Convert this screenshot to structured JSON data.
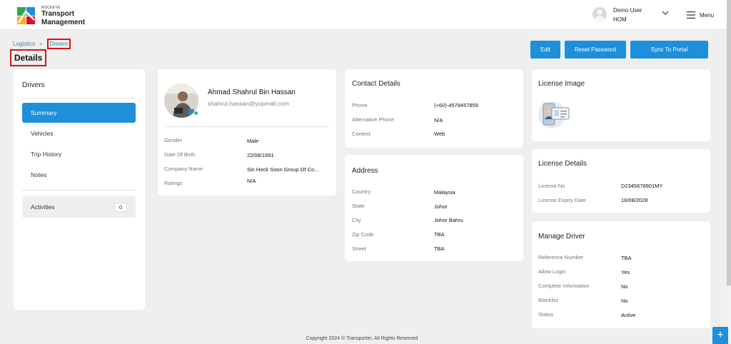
{
  "brand": {
    "tagline": "ROCKEYE",
    "line1": "Transport",
    "line2": "Management"
  },
  "user": {
    "name": "Demo User",
    "role": "HOM",
    "avatar_icon": "user-avatar-icon"
  },
  "menu": {
    "label": "Menu",
    "icon": "hamburger-icon"
  },
  "breadcrumb": {
    "parent": "Logistics",
    "separator": "»",
    "current": "Drivers"
  },
  "page_title": "Details",
  "actions": {
    "edit": "Edit",
    "reset_password": "Reset Password",
    "sync": "Sync To Portal"
  },
  "sidebar": {
    "title": "Drivers",
    "items": [
      {
        "label": "Summary",
        "active": true
      },
      {
        "label": "Vehicles",
        "active": false
      },
      {
        "label": "Trip History",
        "active": false
      },
      {
        "label": "Notes",
        "active": false
      }
    ],
    "activities": {
      "label": "Activities",
      "count": "0"
    }
  },
  "profile": {
    "name": "Ahmad Shahrul Bin Hassan",
    "email": "shahrul.hassan@yopmail.com",
    "status_color": "#2ec246",
    "fields": [
      {
        "label": "Gender",
        "value": "Male"
      },
      {
        "label": "Date Of Birth",
        "value": "22/08/1991"
      },
      {
        "label": "Company Name",
        "value": "Sin Hock Soon Group Of Co..."
      },
      {
        "label": "Ratings",
        "value": "N/A"
      }
    ]
  },
  "contact": {
    "title": "Contact Details",
    "fields": [
      {
        "label": "Phone",
        "value": "(+60)-4578457859"
      },
      {
        "label": "Alternative Phone",
        "value": "N/A"
      },
      {
        "label": "Context",
        "value": "Web"
      }
    ]
  },
  "address": {
    "title": "Address",
    "fields": [
      {
        "label": "Country",
        "value": "Malaysia"
      },
      {
        "label": "State",
        "value": "Johor"
      },
      {
        "label": "City",
        "value": "Johor Bahru"
      },
      {
        "label": "Zip Code",
        "value": "TBA"
      },
      {
        "label": "Street",
        "value": "TBA"
      }
    ]
  },
  "license_image": {
    "title": "License Image",
    "icon": "license-card-icon"
  },
  "license_details": {
    "title": "License Details",
    "fields": [
      {
        "label": "License No",
        "value": "D2345678901MY"
      },
      {
        "label": "License Expiry Date",
        "value": "16/08/2028"
      }
    ]
  },
  "manage_driver": {
    "title": "Manage Driver",
    "fields": [
      {
        "label": "Reference Number",
        "value": "TBA"
      },
      {
        "label": "Allow Login",
        "value": "Yes"
      },
      {
        "label": "Complete Information",
        "value": "No"
      },
      {
        "label": "Blacklist",
        "value": "No"
      },
      {
        "label": "Status",
        "value": "Active"
      }
    ]
  },
  "footer": "Copyright 2024 © Transporter. All Rights Reserved",
  "fab": {
    "label": "+"
  },
  "colors": {
    "accent": "#1e8fd8",
    "highlight": "#d9131c"
  }
}
